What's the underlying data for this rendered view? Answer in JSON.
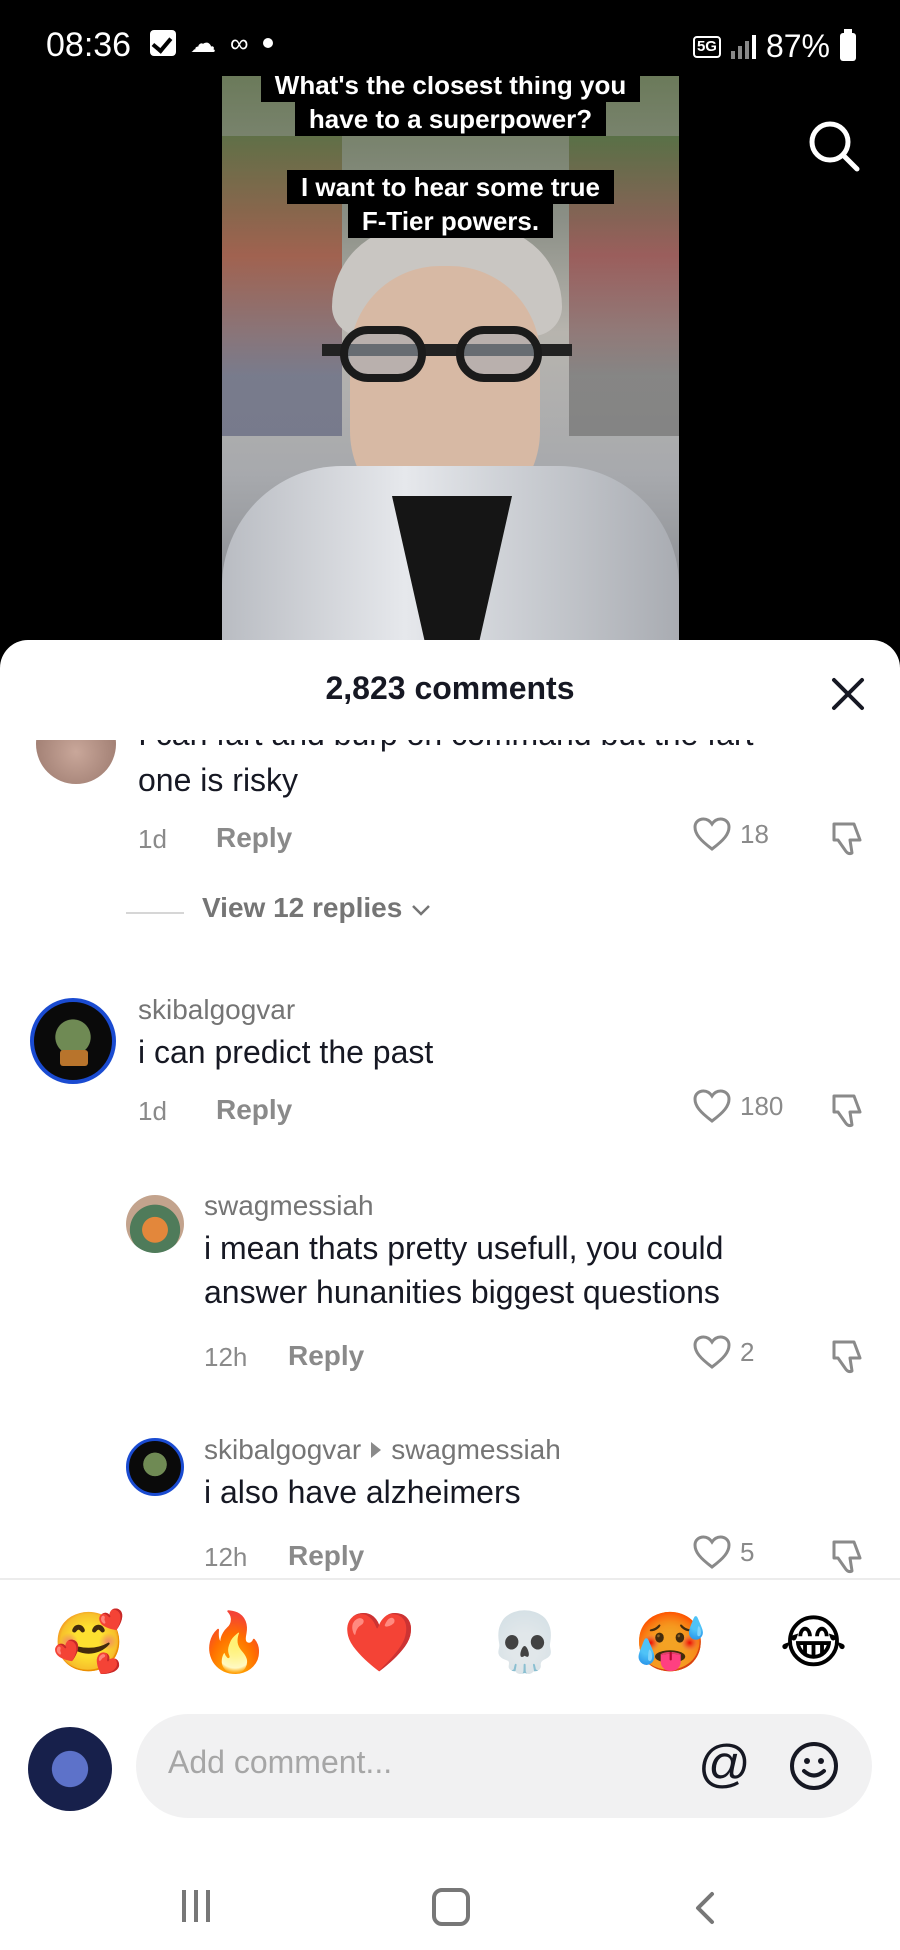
{
  "status_bar": {
    "time": "08:36",
    "network": "5G",
    "battery": "87%"
  },
  "video": {
    "caption_line1": "What's the closest thing you",
    "caption_line2": "have to a superpower?",
    "caption_line3": "I want to hear some true",
    "caption_line4": "F-Tier powers."
  },
  "sheet": {
    "title": "2,823 comments"
  },
  "comments": [
    {
      "text_cut": "I can fart and burp on command but the fart",
      "text": "one is risky",
      "time": "1d",
      "reply_label": "Reply",
      "likes": "18",
      "view_replies": "View 12 replies"
    },
    {
      "username": "skibalgogvar",
      "text": "i can predict the past",
      "time": "1d",
      "reply_label": "Reply",
      "likes": "180"
    },
    {
      "username": "swagmessiah",
      "text_line1": "i mean thats pretty usefull, you could",
      "text_line2": "answer hunanities biggest questions",
      "time": "12h",
      "reply_label": "Reply",
      "likes": "2"
    },
    {
      "username": "skibalgogvar",
      "reply_to": "swagmessiah",
      "text": "i also have alzheimers",
      "time": "12h",
      "reply_label": "Reply",
      "likes": "5"
    }
  ],
  "quick_emojis": [
    "🥰",
    "🔥",
    "❤️",
    "💀",
    "🥵",
    "😂"
  ],
  "composer": {
    "placeholder": "Add comment...",
    "at_symbol": "@"
  },
  "colors": {
    "sheet_bg": "#ffffff",
    "text": "#161823",
    "muted": "#8a8a8a",
    "avatar_ring": "#1a4bd1"
  },
  "icons": [
    "search-icon",
    "close-icon",
    "heart-icon",
    "dislike-icon",
    "chevron-down-icon",
    "smile-icon",
    "back-icon",
    "home-icon",
    "recent-apps-icon"
  ]
}
